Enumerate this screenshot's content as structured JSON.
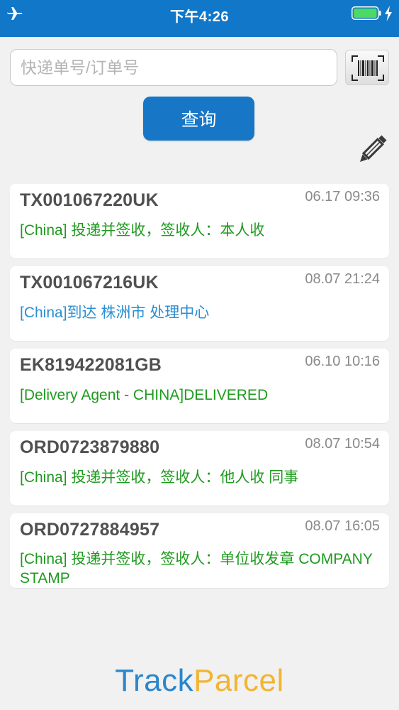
{
  "status_bar": {
    "time": "下午4:26",
    "icons": [
      "airplane-icon",
      "battery-icon",
      "charging-bolt-icon"
    ]
  },
  "search": {
    "placeholder": "快递单号/订单号",
    "value": ""
  },
  "query_button_label": "查询",
  "parcels": [
    {
      "tracking": "TX001067220UK",
      "date": "06.17 09:36",
      "status": "[China] 投递并签收，签收人：本人收",
      "color": "#1e9a1e"
    },
    {
      "tracking": "TX001067216UK",
      "date": "08.07 21:24",
      "status": "[China]到达  株洲市 处理中心",
      "color": "#2b8fd1"
    },
    {
      "tracking": "EK819422081GB",
      "date": "06.10 10:16",
      "status": "[Delivery Agent - CHINA]DELIVERED",
      "color": "#1e9a1e"
    },
    {
      "tracking": "ORD0723879880",
      "date": "08.07 10:54",
      "status": "[China] 投递并签收，签收人：他人收 同事",
      "color": "#1e9a1e"
    },
    {
      "tracking": "ORD0727884957",
      "date": "08.07 16:05",
      "status": "[China] 投递并签收，签收人：单位收发章 COMPANY STAMP",
      "color": "#1e9a1e"
    }
  ],
  "brand": {
    "part1": "Track",
    "part2": "Parcel"
  },
  "colors": {
    "header": "#1077c9",
    "button": "#1777c6",
    "delivered": "#1e9a1e",
    "in_transit": "#2b8fd1",
    "brand_blue": "#2a86cc",
    "brand_orange": "#f2b431"
  }
}
